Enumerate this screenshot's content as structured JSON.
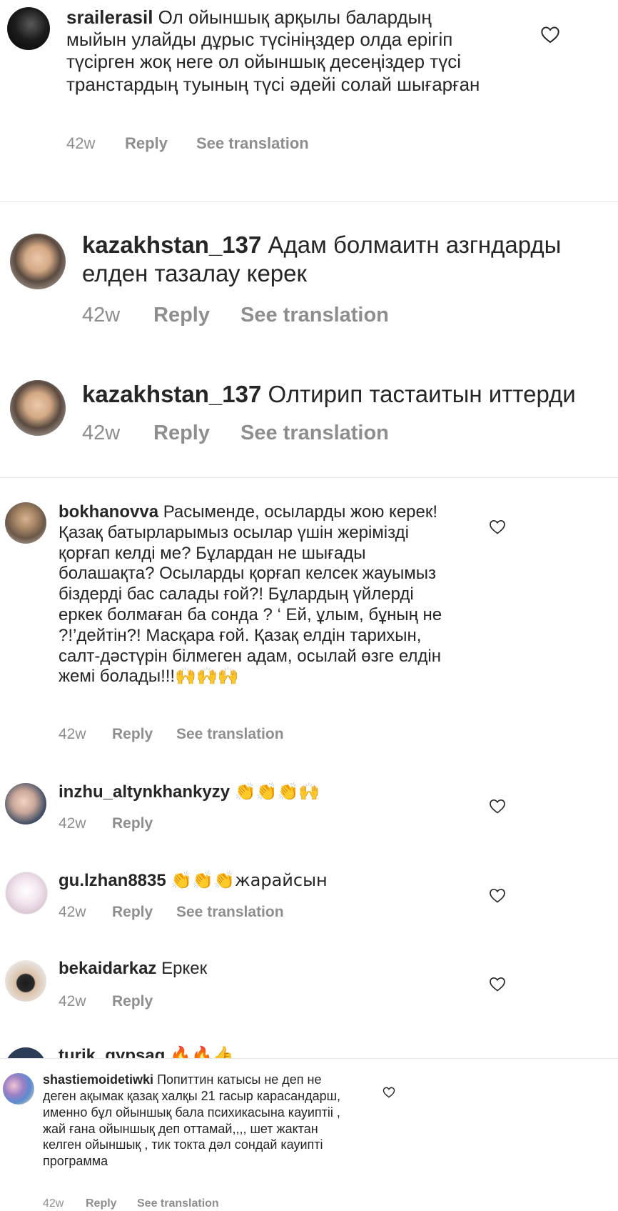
{
  "comments": [
    {
      "username": "srailerasil",
      "text": "Ол ойыншық арқылы балардың мыйын улайды дұрыс түсініңздер олда ерігіп түсірген жоқ неге ол ойыншық десеңіздер түсі транстардың туының түсі әдейі солай шығарған",
      "time": "42w",
      "reply": "Reply",
      "translate": "See translation"
    },
    {
      "username": "kazakhstan_137",
      "text": "Адам болмаитн азгндарды елден тазалау керек",
      "time": "42w",
      "reply": "Reply",
      "translate": "See translation"
    },
    {
      "username": "kazakhstan_137",
      "text": "Олтирип тастаитын иттерди",
      "time": "42w",
      "reply": "Reply",
      "translate": "See translation"
    },
    {
      "username": "bokhanovva",
      "text": "Расыменде, осыларды жою керек! Қазақ батырларымыз осылар үшін жерімізді қорғап келді ме? Бұлардан не шығады болашақта? Осыларды қорғап келсек жауымыз біздерді бас салады ғой?! Бұлардың үйлерді еркек болмаған ба сонда ? ‘ Ей, ұлым, бұның не ?!’дейтін?! Масқара ғой. Қазақ елдін тарихын, салт-дәстүрін білмеген адам, осылай өзге елдін жемі болады!!!🙌🙌🙌",
      "time": "42w",
      "reply": "Reply",
      "translate": "See translation"
    },
    {
      "username": "inzhu_altynkhankyzy",
      "text": "👏👏👏🙌",
      "time": "42w",
      "reply": "Reply"
    },
    {
      "username": "gu.lzhan8835",
      "text": "👏👏👏жарайсын",
      "time": "42w",
      "reply": "Reply",
      "translate": "See translation"
    },
    {
      "username": "bekaidarkaz",
      "text": "Еркек",
      "time": "42w",
      "reply": "Reply"
    },
    {
      "username": "turik_qypsaq",
      "text": "🔥🔥👍"
    },
    {
      "username": "shastiemoidetiwki",
      "text": "Попиттин катысы не деп не деген ақымак қазақ халқы 21 гасыр карасандарш, именно бұл ойыншық бала психикасына кауиптii ,  жай ғана ойыншық деп оттамай,,,, шет жактан келген ойыншық , тик токта дәл сондай кауипті программа",
      "time": "42w",
      "reply": "Reply",
      "translate": "See translation"
    }
  ],
  "icons": {
    "heart": "heart-outline-icon"
  }
}
